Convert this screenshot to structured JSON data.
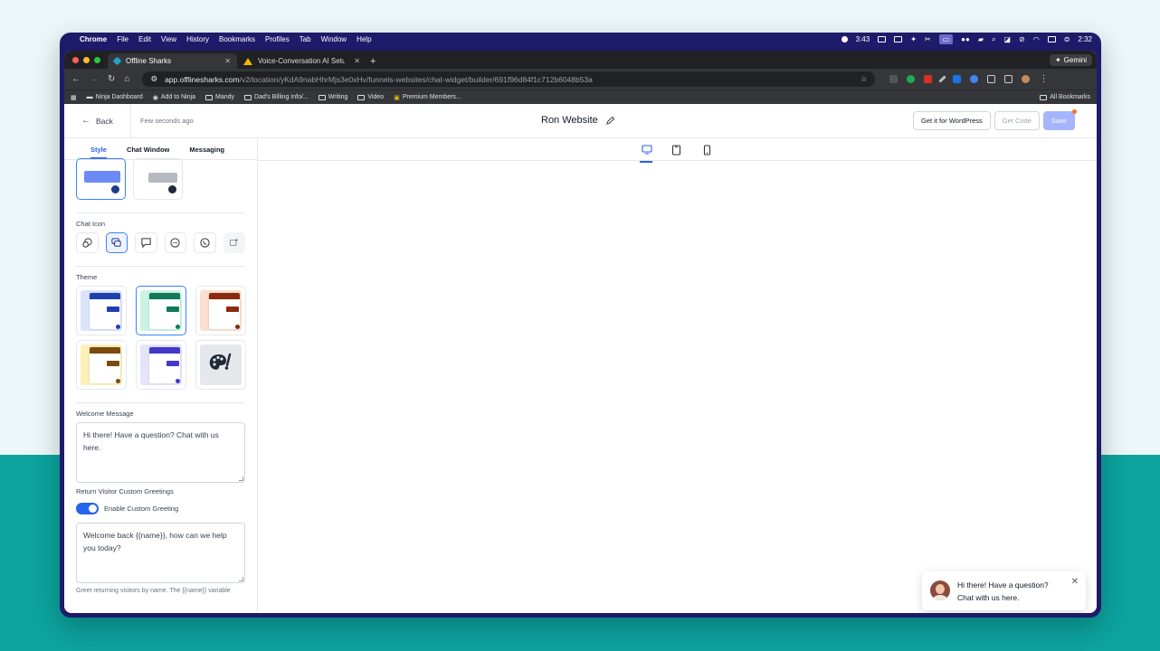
{
  "menubar": {
    "items": [
      "Chrome",
      "File",
      "Edit",
      "View",
      "History",
      "Bookmarks",
      "Profiles",
      "Tab",
      "Window",
      "Help"
    ],
    "timer": "3:43",
    "clock": "2:32"
  },
  "browser": {
    "tabs": [
      {
        "title": "Offline Sharks",
        "active": true
      },
      {
        "title": "Voice-Conversation AI Setup",
        "active": false
      }
    ],
    "gemini_label": "Gemini",
    "url_host": "app.offlinesharks.com",
    "url_path": "/v2/location/yKdA9nabHhrMjs3e0xHv/funnels-websites/chat-widget/builder/691f96d84f1c712b6048b53a",
    "bookmarks": [
      "Ninja Dashboard",
      "Add to Ninja",
      "Mandy",
      "Dad's Billing Info/...",
      "Writing",
      "Video",
      "Premium Members..."
    ],
    "all_bookmarks": "All Bookmarks"
  },
  "header": {
    "back_label": "Back",
    "saved_status": "Few seconds ago",
    "title": "Ron Website",
    "wordpress_btn": "Get it for WordPress",
    "get_code_btn": "Get Code",
    "save_btn": "Save"
  },
  "sidebar": {
    "tabs": [
      "Style",
      "Chat Window",
      "Messaging"
    ],
    "chat_icon_label": "Chat Icon",
    "theme_label": "Theme",
    "themes": [
      {
        "bg": "#dbe4fb",
        "accent": "#1e40af",
        "selected": false
      },
      {
        "bg": "#c9f3e3",
        "accent": "#0e7a5a",
        "selected": true
      },
      {
        "bg": "#fbe0cf",
        "accent": "#8b2a0e",
        "selected": false
      },
      {
        "bg": "#fdf0b8",
        "accent": "#7a4a0e",
        "selected": false
      },
      {
        "bg": "#e3e6fb",
        "accent": "#4338ca",
        "selected": false
      },
      {
        "bg": "#e5e7eb",
        "accent": "#1f2937",
        "selected": false
      }
    ],
    "welcome_label": "Welcome Message",
    "welcome_text": "Hi there! Have a question? Chat with us here.",
    "return_label": "Return Visitor Custom Greetings",
    "toggle_label": "Enable Custom Greeting",
    "return_text": "Welcome back {{name}}, how can we help you today?",
    "help_text": "Greet returning visitors by name. The {{name}} variable"
  },
  "preview": {
    "bubble_text": "Hi there! Have a question? Chat with us here.",
    "fab_color": "#0f9d58"
  }
}
